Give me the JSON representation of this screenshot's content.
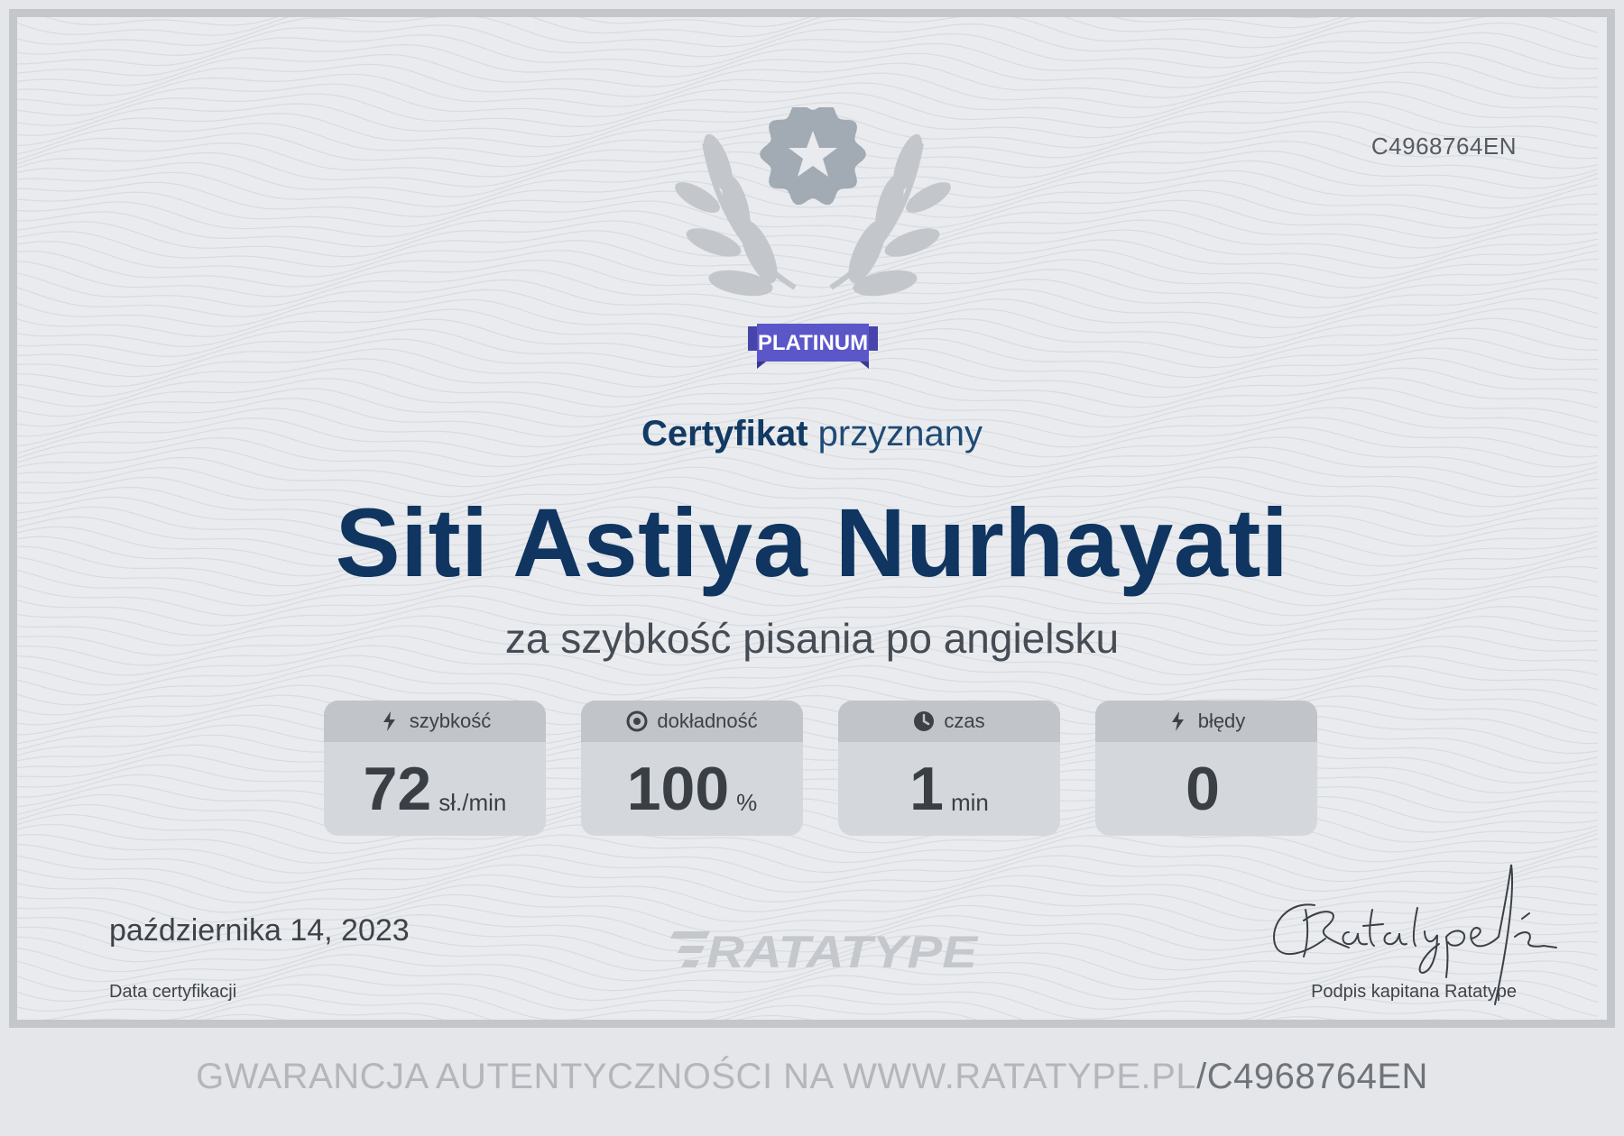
{
  "certificate": {
    "id": "C4968764EN",
    "badge_label": "PLATINUM",
    "heading_bold": "Certyfikat",
    "heading_rest": "przyznany",
    "name": "Siti Astiya Nurhayati",
    "subtitle": "za szybkość pisania po angielsku",
    "date": "października 14, 2023",
    "date_label": "Data certyfikacji",
    "logo_text": "RATATYPE",
    "signature_label": "Podpis kapitana Ratatype"
  },
  "stats": [
    {
      "label": "szybkość",
      "value": "72",
      "unit": "sł./min",
      "icon": "lightning-icon"
    },
    {
      "label": "dokładność",
      "value": "100",
      "unit": "%",
      "icon": "target-icon"
    },
    {
      "label": "czas",
      "value": "1",
      "unit": "min",
      "icon": "clock-icon"
    },
    {
      "label": "błędy",
      "value": "0",
      "unit": "",
      "icon": "lightning-icon"
    }
  ],
  "footer": {
    "guarantee_text": "GWARANCJA AUTENTYCZNOŚCI NA WWW.RATATYPE.PL",
    "code_text": "/C4968764EN"
  },
  "colors": {
    "name": "#0f3560",
    "badge_ribbon": "#5b57c8",
    "badge_medal": "#a2aab3",
    "laurel": "#c2c5c9"
  }
}
